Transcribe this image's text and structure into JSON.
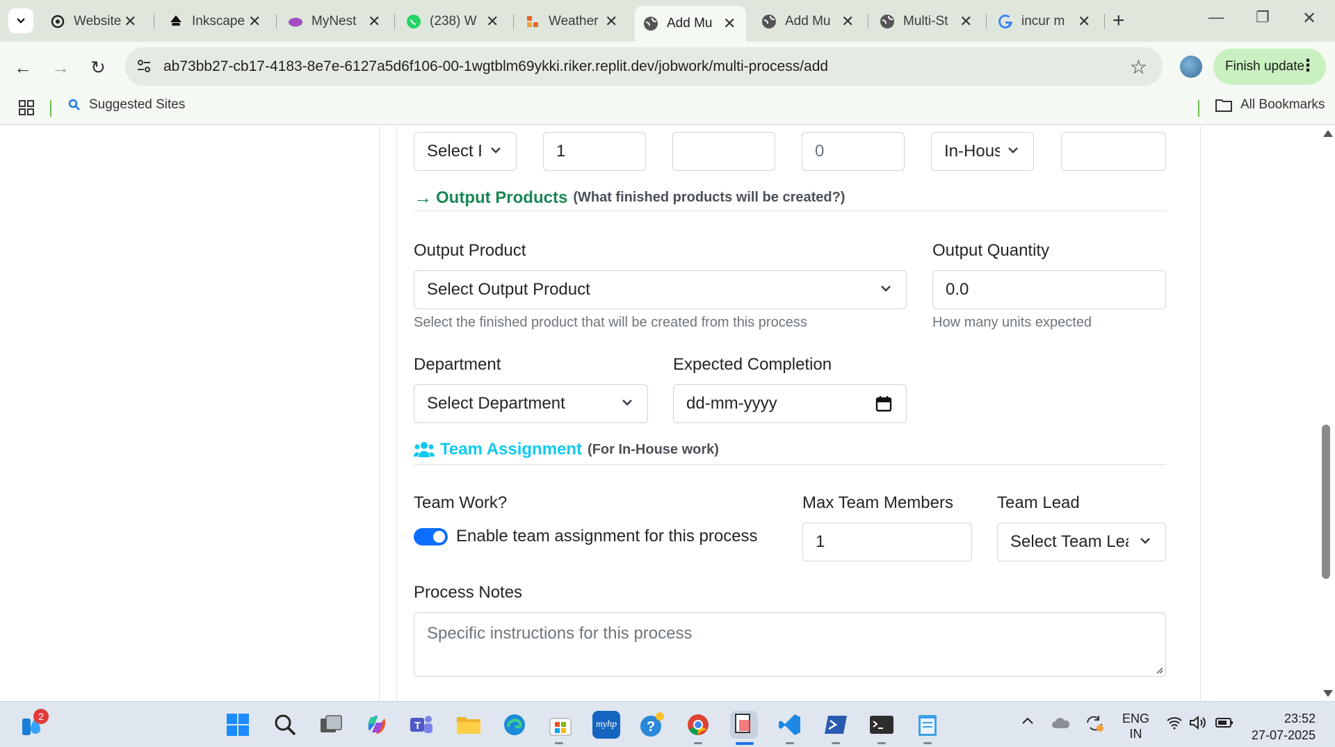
{
  "browser": {
    "tabs": [
      {
        "title": "Website",
        "icon": "openai-icon"
      },
      {
        "title": "Inkscape",
        "icon": "inkscape-icon"
      },
      {
        "title": "MyNest",
        "icon": "mynest-icon"
      },
      {
        "title": "(238) W",
        "icon": "whatsapp-icon"
      },
      {
        "title": "Weather",
        "icon": "weather-icon"
      },
      {
        "title": "Add Mu",
        "icon": "globe-icon"
      },
      {
        "title": "Add Mu",
        "icon": "globe-icon"
      },
      {
        "title": "Multi-St",
        "icon": "globe-icon"
      },
      {
        "title": "incur m",
        "icon": "google-icon"
      }
    ],
    "active_tab_index": 5,
    "url": "ab73bb27-cb17-4183-8e7e-6127a5d6f106-00-1wgtblm69ykki.riker.replit.dev/jobwork/multi-process/add",
    "finish_update_label": "Finish update",
    "bookmarks": {
      "suggested": "Suggested Sites",
      "all": "All Bookmarks"
    }
  },
  "form": {
    "top_row": {
      "select_1": "Select P",
      "qty": "1",
      "field_3": "",
      "field_4": "0",
      "work_type": "In-House",
      "field_6": ""
    },
    "output_section": {
      "title": "Output Products",
      "subtitle": "(What finished products will be created?)"
    },
    "output_product": {
      "label": "Output Product",
      "value": "Select Output Product",
      "help": "Select the finished product that will be created from this process"
    },
    "output_quantity": {
      "label": "Output Quantity",
      "value": "0.0",
      "help": "How many units expected"
    },
    "department": {
      "label": "Department",
      "value": "Select Department"
    },
    "expected_completion": {
      "label": "Expected Completion",
      "placeholder": "dd-mm-yyyy"
    },
    "team_section": {
      "title": "Team Assignment",
      "subtitle": "(For In-House work)"
    },
    "team_work": {
      "label": "Team Work?",
      "toggle_label": "Enable team assignment for this process",
      "enabled": true
    },
    "max_team_members": {
      "label": "Max Team Members",
      "value": "1"
    },
    "team_lead": {
      "label": "Team Lead",
      "value": "Select Team Lead"
    },
    "process_notes": {
      "label": "Process Notes",
      "placeholder": "Specific instructions for this process"
    }
  },
  "taskbar": {
    "notification_count": "2",
    "language": "ENG",
    "region": "IN",
    "time": "23:52",
    "date": "27-07-2025"
  },
  "colors": {
    "output_green": "#198754",
    "team_cyan": "#0dcaf0",
    "primary_blue": "#0d6efd"
  }
}
